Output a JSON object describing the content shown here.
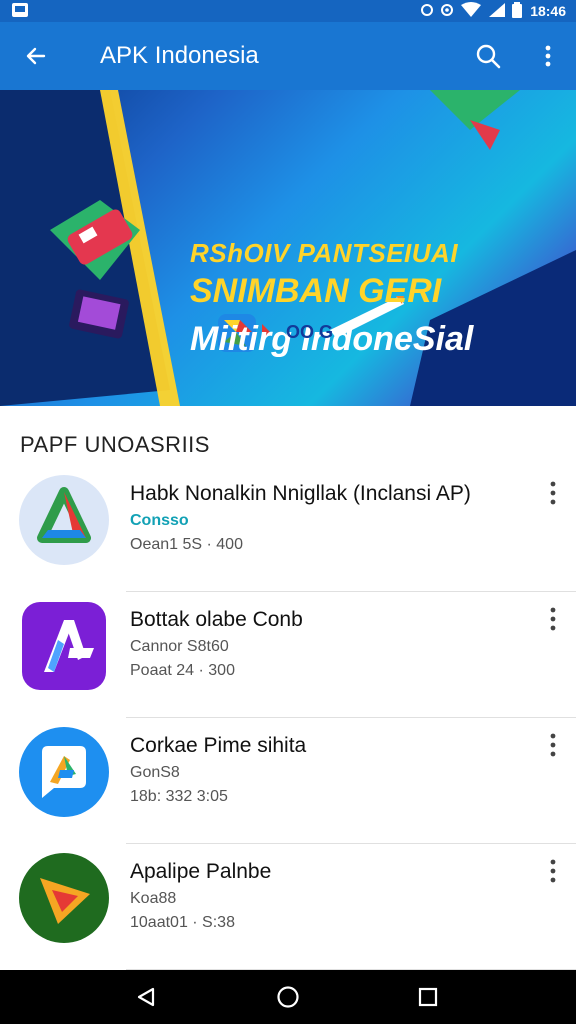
{
  "status_bar": {
    "time": "18:46",
    "icons": [
      "notification-icon",
      "alarm-icon",
      "data-icon",
      "wifi-icon",
      "signal-icon",
      "battery-icon"
    ]
  },
  "app_bar": {
    "title": "APK Indonesia",
    "icons": [
      "back-arrow-icon",
      "search-icon",
      "more-vert-icon"
    ]
  },
  "banner": {
    "line1": "RShOIV PANTSEIUAI",
    "line2": "SNIMBAN GERI",
    "line3": "Miitirg IndoneSial",
    "logo_text": "OO G"
  },
  "section": {
    "title": "PAPF UNOASRIIS"
  },
  "apps": [
    {
      "name": "Habk Nonalkin Nnigllak (Inclansi AP)",
      "meta1": "Consso",
      "meta2": "Oean1 5S · 400",
      "icon": "triangle-app-icon"
    },
    {
      "name": "Bottak olabe Conb",
      "meta1": "Cannor S8t60",
      "meta2": "Poaat 24 · 300",
      "icon": "letter-a-app-icon"
    },
    {
      "name": "Corkae Pime sihita",
      "meta1": "GonS8",
      "meta2": "18b: 332 3:05",
      "icon": "chat-bubble-app-icon"
    },
    {
      "name": "Apalipe Palnbe",
      "meta1": "Koa88",
      "meta2": "10aat01 · S:38",
      "icon": "play-arrow-app-icon"
    }
  ],
  "colors": {
    "app_bar": "#1976d2",
    "status_bar": "#1565c0",
    "banner_yellow": "#ffd42a",
    "accent_teal": "#12a1b5"
  },
  "nav_bar": {
    "icons": [
      "back-triangle-icon",
      "home-circle-icon",
      "recents-square-icon"
    ]
  }
}
